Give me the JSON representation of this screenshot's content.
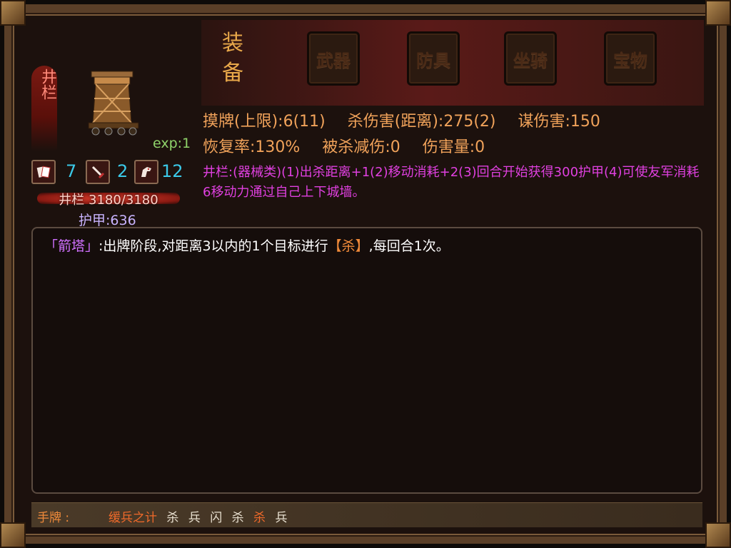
{
  "unit": {
    "name": "井栏",
    "exp": "exp:1",
    "stats": {
      "cards": "7",
      "attack": "2",
      "move": "12"
    },
    "hp": "井栏 3180/3180",
    "armor": "护甲:636"
  },
  "equipment": {
    "title": "装备",
    "slots": [
      "武器",
      "防具",
      "坐骑",
      "宝物"
    ]
  },
  "attributes": {
    "line1": [
      "摸牌(上限):6(11)",
      "杀伤害(距离):275(2)",
      "谋伤害:150"
    ],
    "line2": [
      "恢复率:130%",
      "被杀减伤:0",
      "伤害量:0"
    ],
    "description": "井栏:(器械类)(1)出杀距离+1(2)移动消耗+2(3)回合开始获得300护甲(4)可使友军消耗6移动力通过自己上下城墙。"
  },
  "skill": {
    "name": "「箭塔」",
    "text_before": ":出牌阶段,对距离3以内的1个目标进行",
    "kill": "【杀】",
    "text_after": ",每回合1次。"
  },
  "hand": {
    "label": "手牌 : ",
    "cards": [
      {
        "text": "缓兵之计",
        "highlight": true
      },
      {
        "text": "杀",
        "highlight": false
      },
      {
        "text": "兵",
        "highlight": false
      },
      {
        "text": "闪",
        "highlight": false
      },
      {
        "text": "杀",
        "highlight": false
      },
      {
        "text": "杀",
        "highlight": true
      },
      {
        "text": "兵",
        "highlight": false
      }
    ]
  },
  "colors": {
    "accent": "#f0a25a",
    "desc": "#e040e0",
    "stat": "#3bc9e8",
    "exp": "#8fd36a"
  },
  "icons": [
    "card-icon",
    "sword-icon",
    "horse-icon"
  ]
}
